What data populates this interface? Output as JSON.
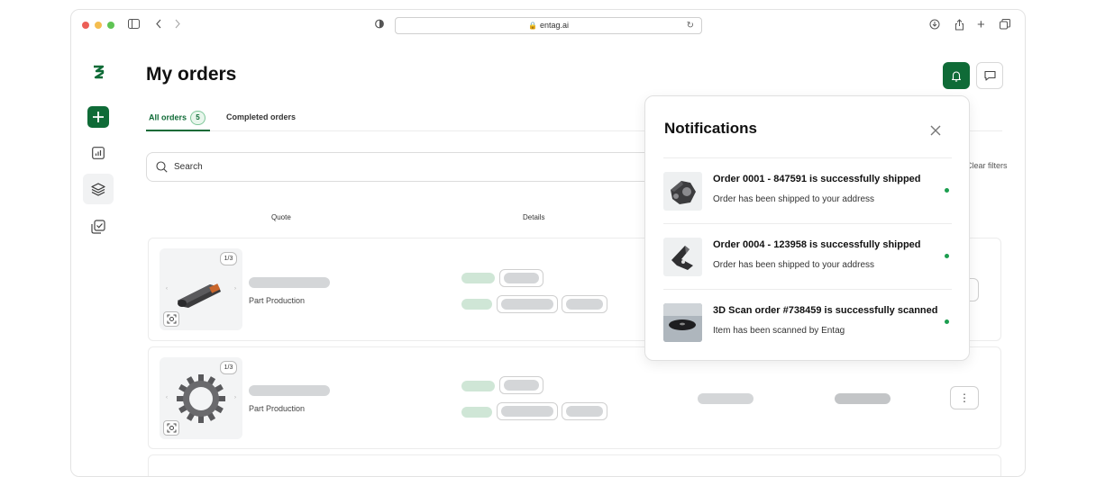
{
  "browser": {
    "url": "entag.ai",
    "traffic_colors": [
      "#ec5f57",
      "#f4bd4f",
      "#5fc454"
    ]
  },
  "brand": {
    "accent": "#0f6b37"
  },
  "page": {
    "title": "My orders"
  },
  "tabs": [
    {
      "label": "All orders",
      "count": "5",
      "active": true
    },
    {
      "label": "Completed orders",
      "active": false
    }
  ],
  "search": {
    "placeholder": "Search"
  },
  "filters": {
    "clear_label": "Clear filters"
  },
  "table": {
    "headers": {
      "quote": "Quote",
      "details": "Details"
    },
    "rows": [
      {
        "page_indicator": "1/3",
        "type": "Part Production",
        "image": "part-image"
      },
      {
        "page_indicator": "1/3",
        "type": "Part Production",
        "image": "gear-image"
      }
    ]
  },
  "notifications": {
    "title": "Notifications",
    "items": [
      {
        "title": "Order 0001 - 847591 is successfully shipped",
        "subtitle": "Order has been shipped to your address",
        "unread": true
      },
      {
        "title": "Order 0004 - 123958 is successfully shipped",
        "subtitle": "Order has been shipped to your address",
        "unread": true
      },
      {
        "title": "3D Scan order #738459 is successfully scanned",
        "subtitle": "Item has been scanned by Entag",
        "unread": true
      }
    ]
  },
  "icons": [
    "sidebar-icon",
    "back-icon",
    "forward-icon",
    "shield-icon",
    "lock-icon",
    "reload-icon",
    "download-icon",
    "share-icon",
    "plus-icon",
    "tabs-icon",
    "logo-icon",
    "add-icon",
    "chart-icon",
    "layers-icon",
    "checklist-icon",
    "bell-icon",
    "chat-icon",
    "search-icon",
    "close-icon",
    "scan-icon",
    "more-icon"
  ]
}
